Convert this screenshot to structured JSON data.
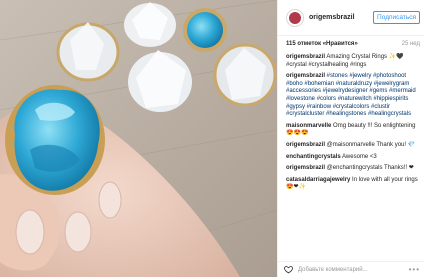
{
  "header": {
    "username": "origemsbrazil",
    "follow_label": "Подписаться"
  },
  "stats": {
    "likes": "115 отметок «Нравится»",
    "age": "25 нед"
  },
  "comments": [
    {
      "author": "origemsbrazil",
      "text": " Amazing Crystal Rings ✨🖤 #crystal #crystalhealing #rings"
    },
    {
      "author": "origemsbrazil",
      "text": " #stones #jewelry #photoshoot #boho #bohemian #naturaldruzy #jewelrygram #accessories #jewelrydesigner #gems #mermaid #lovestone #colors #naturewitch #hippiespirits #gypsy #rainbow #crystalcolors #clustir #crystalcluster #healingstones #healingcrystals"
    },
    {
      "author": "maisonmarvelle",
      "text": " Omg beauty !!! So enlightening 😍😍😍"
    },
    {
      "author": "origemsbrazil",
      "text": " @maisonmarvelle Thank you! 💎"
    },
    {
      "author": "enchantingcrystals",
      "text": " Awesome <3"
    },
    {
      "author": "origemsbrazil",
      "text": " @enchantingcrystals Thanks!! ❤"
    },
    {
      "author": "catasaldarriagajewelry",
      "text": " In love with all your rings 😍❤✨"
    }
  ],
  "bottom": {
    "placeholder": "Добавьте комментарий...",
    "more": "•••"
  },
  "colors": {
    "link": "#3897f0",
    "tag": "#003569",
    "stone_blue": "#2fa9d6"
  },
  "icons": [
    "heart-icon",
    "more-icon"
  ]
}
